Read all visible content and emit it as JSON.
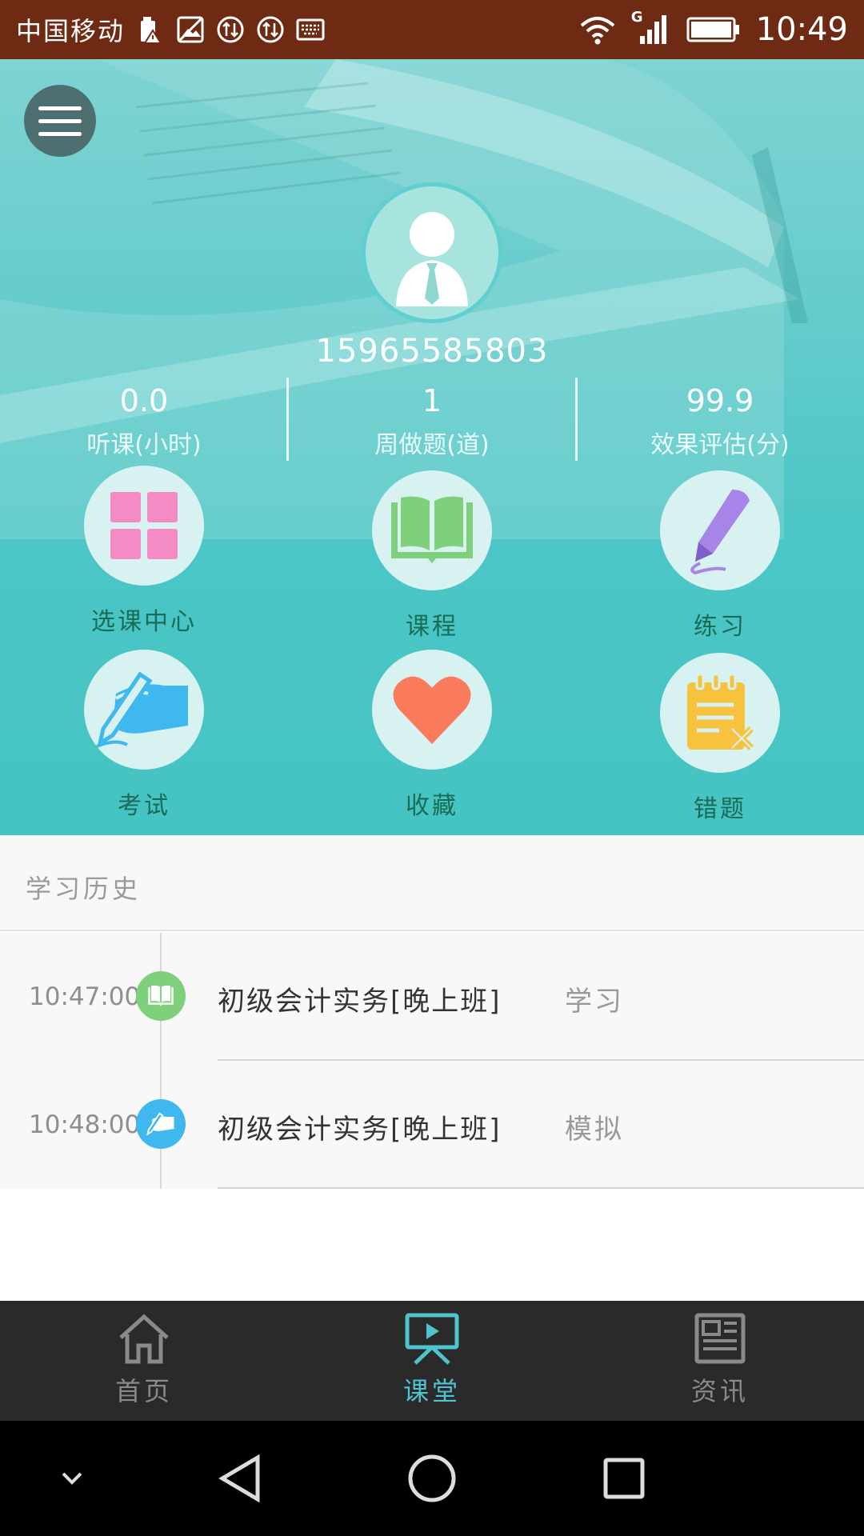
{
  "status_bar": {
    "carrier": "中国移动",
    "time": "10:49",
    "network": "G"
  },
  "profile": {
    "phone": "15965585803"
  },
  "stats": [
    {
      "value": "0.0",
      "label": "听课(小时)"
    },
    {
      "value": "1",
      "label": "周做题(道)"
    },
    {
      "value": "99.9",
      "label": "效果评估(分)"
    }
  ],
  "menu": [
    {
      "label": "选课中心",
      "icon": "grid-icon"
    },
    {
      "label": "课程",
      "icon": "book-icon"
    },
    {
      "label": "练习",
      "icon": "pencil-icon"
    },
    {
      "label": "考试",
      "icon": "hand-writing-icon"
    },
    {
      "label": "收藏",
      "icon": "heart-icon"
    },
    {
      "label": "错题",
      "icon": "notepad-icon"
    }
  ],
  "history": {
    "title": "学习历史",
    "items": [
      {
        "time": "10:47:00",
        "title": "初级会计实务[晚上班]",
        "kind": "学习",
        "icon": "book-icon",
        "color": "#7ed07a"
      },
      {
        "time": "10:48:00",
        "title": "初级会计实务[晚上班]",
        "kind": "模拟",
        "icon": "hand-writing-icon",
        "color": "#3fb8f0"
      }
    ]
  },
  "tabs": [
    {
      "label": "首页",
      "icon": "home-icon",
      "active": false
    },
    {
      "label": "课堂",
      "icon": "classroom-icon",
      "active": true
    },
    {
      "label": "资讯",
      "icon": "news-icon",
      "active": false
    }
  ],
  "colors": {
    "status_bar": "#6e2a12",
    "hero": "#4cc6c6",
    "tab_active": "#4fc3cf",
    "tab_inactive": "#8a8a8a",
    "menu_label": "#1a6c55"
  }
}
